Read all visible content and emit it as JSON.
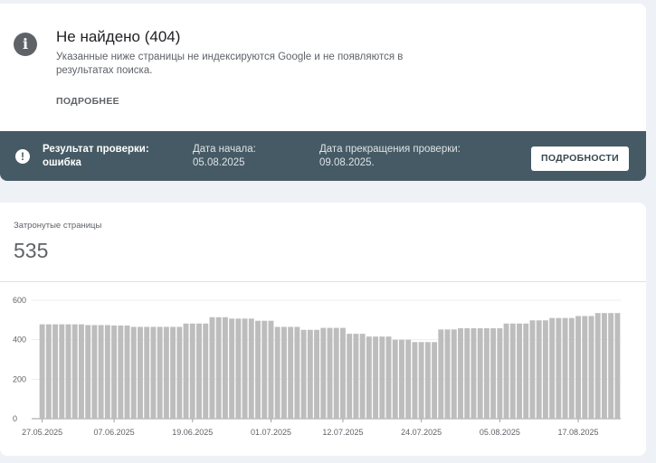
{
  "issue": {
    "icon": "info-icon",
    "title": "Не найдено (404)",
    "description": "Указанные ниже страницы не индексируются Google и не появляются в результатах поиска.",
    "learn_more_label": "ПОДРОБНЕЕ"
  },
  "validation": {
    "icon": "warning-icon",
    "status_label": "Результат проверки: ошибка",
    "start_date_label": "Дата начала: 05.08.2025",
    "end_date_label": "Дата прекращения проверки: 09.08.2025.",
    "details_button_label": "ПОДРОБНОСТИ"
  },
  "metric": {
    "label": "Затронутые страницы",
    "value": "535"
  },
  "colors": {
    "status_bar": "#455a64",
    "bar": "#bdbdbd"
  },
  "chart_data": {
    "type": "bar",
    "title": "",
    "xlabel": "",
    "ylabel": "",
    "ylim": [
      0,
      600
    ],
    "y_ticks": [
      0,
      200,
      400,
      600
    ],
    "x_tick_labels": [
      "27.05.2025",
      "07.06.2025",
      "19.06.2025",
      "01.07.2025",
      "12.07.2025",
      "24.07.2025",
      "05.08.2025",
      "17.08.2025"
    ],
    "x_tick_indices": [
      0,
      11,
      23,
      35,
      46,
      58,
      70,
      82
    ],
    "grid": true,
    "series": [
      {
        "values": [
          478,
          478,
          478,
          478,
          478,
          478,
          478,
          474,
          474,
          474,
          474,
          472,
          472,
          472,
          465,
          465,
          465,
          465,
          465,
          465,
          465,
          465,
          482,
          482,
          482,
          482,
          514,
          514,
          514,
          507,
          507,
          507,
          507,
          496,
          496,
          496,
          465,
          465,
          465,
          465,
          450,
          450,
          450,
          460,
          460,
          460,
          460,
          430,
          430,
          430,
          416,
          416,
          416,
          416,
          400,
          400,
          400,
          388,
          388,
          388,
          388,
          452,
          452,
          452,
          458,
          458,
          458,
          458,
          458,
          458,
          458,
          482,
          482,
          482,
          482,
          498,
          498,
          498,
          510,
          510,
          510,
          510,
          520,
          520,
          520,
          535,
          535,
          535,
          535
        ]
      }
    ]
  }
}
